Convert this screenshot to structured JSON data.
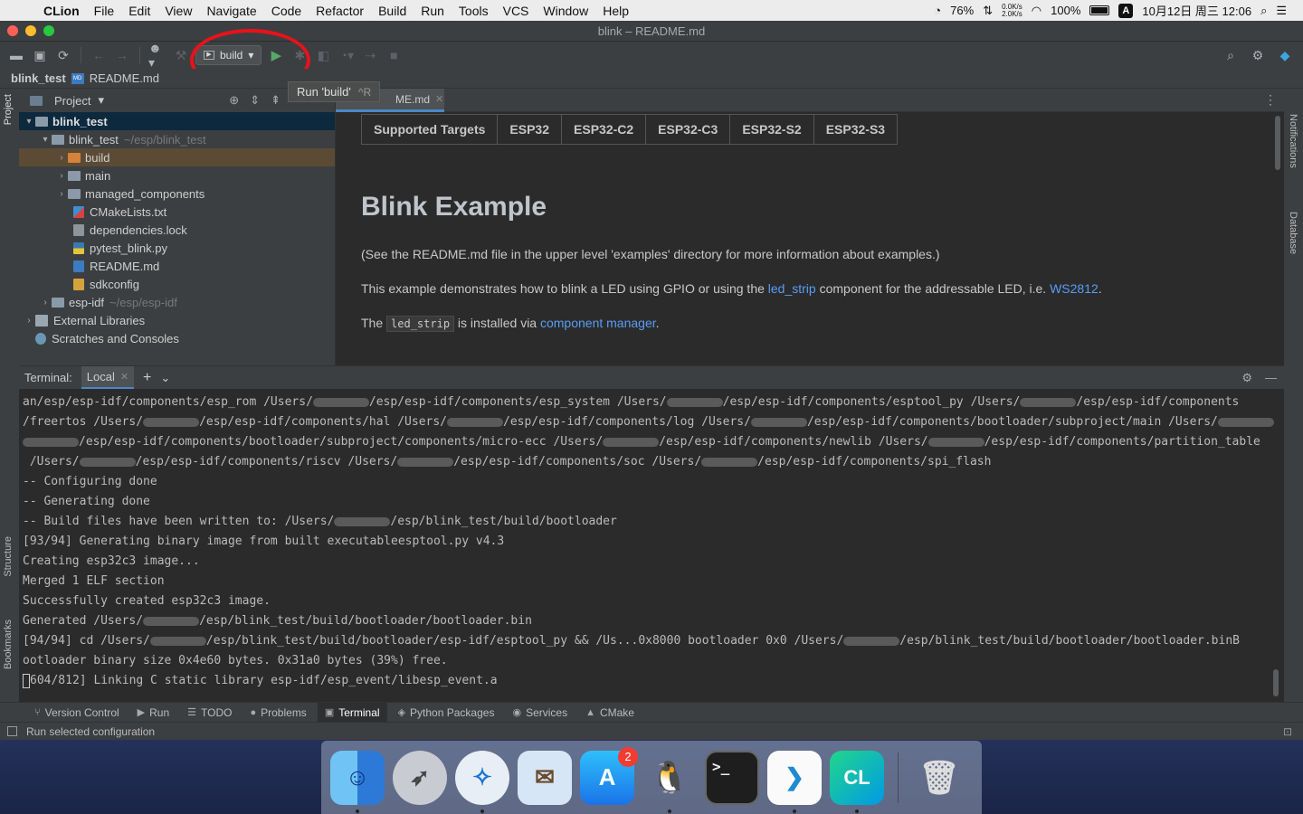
{
  "menubar": {
    "apple": "",
    "app": "CLion",
    "items": [
      "File",
      "Edit",
      "View",
      "Navigate",
      "Code",
      "Refactor",
      "Build",
      "Run",
      "Tools",
      "VCS",
      "Window",
      "Help"
    ],
    "status": {
      "cpu": "76%",
      "net_up": "0.0K/s",
      "net_down": "2.0K/s",
      "battery": "100%",
      "input": "A",
      "datetime": "10月12日 周三  12:06"
    }
  },
  "window": {
    "title": "blink – README.md"
  },
  "toolbar": {
    "config_name": "build",
    "tooltip_label": "Run 'build'",
    "tooltip_shortcut": "^R"
  },
  "breadcrumb": {
    "project": "blink_test",
    "file": "README.md"
  },
  "project_panel": {
    "title": "Project",
    "tree": [
      {
        "label": "blink_test",
        "path": ""
      },
      {
        "label": "blink_test",
        "path": "~/esp/blink_test"
      },
      {
        "label": "build",
        "path": ""
      },
      {
        "label": "main",
        "path": ""
      },
      {
        "label": "managed_components",
        "path": ""
      },
      {
        "label": "CMakeLists.txt",
        "path": ""
      },
      {
        "label": "dependencies.lock",
        "path": ""
      },
      {
        "label": "pytest_blink.py",
        "path": ""
      },
      {
        "label": "README.md",
        "path": ""
      },
      {
        "label": "sdkconfig",
        "path": ""
      },
      {
        "label": "esp-idf",
        "path": "~/esp/esp-idf"
      },
      {
        "label": "External Libraries",
        "path": ""
      },
      {
        "label": "Scratches and Consoles",
        "path": ""
      }
    ]
  },
  "editor": {
    "tab_label": "ME.md",
    "table_headers": [
      "Supported Targets",
      "ESP32",
      "ESP32-C2",
      "ESP32-C3",
      "ESP32-S2",
      "ESP32-S3"
    ],
    "heading": "Blink Example",
    "p1": "(See the README.md file in the upper level 'examples' directory for more information about examples.)",
    "p2_a": "This example demonstrates how to blink a LED using GPIO or using the ",
    "p2_link1": "led_strip",
    "p2_b": " component for the addressable LED, i.e. ",
    "p2_link2": "WS2812",
    "p2_c": ".",
    "p3_a": "The ",
    "p3_code": "led_strip",
    "p3_b": " is installed via ",
    "p3_link": "component manager",
    "p3_c": "."
  },
  "terminal": {
    "label": "Terminal:",
    "tab": "Local",
    "lines": [
      [
        "an/esp/esp-idf/components/esp_rom /Users/",
        "R",
        "/esp/esp-idf/components/esp_system /Users/",
        "R",
        "/esp/esp-idf/components/esptool_py /Users/",
        "R",
        "/esp/esp-idf/components"
      ],
      [
        "/freertos /Users/",
        "R",
        "/esp/esp-idf/components/hal /Users/",
        "R",
        "/esp/esp-idf/components/log /Users/",
        "R",
        "/esp/esp-idf/components/bootloader/subproject/main /Users/",
        "R"
      ],
      [
        "",
        "R",
        "/esp/esp-idf/components/bootloader/subproject/components/micro-ecc /Users/",
        "R",
        "/esp/esp-idf/components/newlib /Users/",
        "R",
        "/esp/esp-idf/components/partition_table"
      ],
      [
        " /Users/",
        "R",
        "/esp/esp-idf/components/riscv /Users/",
        "R",
        "/esp/esp-idf/components/soc /Users/",
        "R",
        "/esp/esp-idf/components/spi_flash"
      ],
      [
        "-- Configuring done"
      ],
      [
        "-- Generating done"
      ],
      [
        "-- Build files have been written to: /Users/",
        "R",
        "/esp/blink_test/build/bootloader"
      ],
      [
        "[93/94] Generating binary image from built executableesptool.py v4.3"
      ],
      [
        "Creating esp32c3 image..."
      ],
      [
        "Merged 1 ELF section"
      ],
      [
        "Successfully created esp32c3 image."
      ],
      [
        "Generated /Users/",
        "R",
        "/esp/blink_test/build/bootloader/bootloader.bin"
      ],
      [
        "[94/94] cd /Users/",
        "R",
        "/esp/blink_test/build/bootloader/esp-idf/esptool_py && /Us...0x8000 bootloader 0x0 /Users/",
        "R",
        "/esp/blink_test/build/bootloader/bootloader.binB"
      ],
      [
        "ootloader binary size 0x4e60 bytes. 0x31a0 bytes (39%) free."
      ],
      [
        "C",
        "604/812] Linking C static library esp-idf/esp_event/libesp_event.a"
      ]
    ]
  },
  "side_labels": {
    "project": "Project",
    "structure": "Structure",
    "bookmarks": "Bookmarks",
    "notifications": "Notifications",
    "database": "Database"
  },
  "tool_tabs": [
    "Version Control",
    "Run",
    "TODO",
    "Problems",
    "Terminal",
    "Python Packages",
    "Services",
    "CMake"
  ],
  "status": {
    "message": "Run selected configuration"
  },
  "dock": {
    "appstore_badge": "2",
    "clion_text": "CL",
    "term_text": ">_"
  },
  "colors": {
    "annotation": "#e8121b",
    "link": "#589df6",
    "run": "#59a869"
  }
}
